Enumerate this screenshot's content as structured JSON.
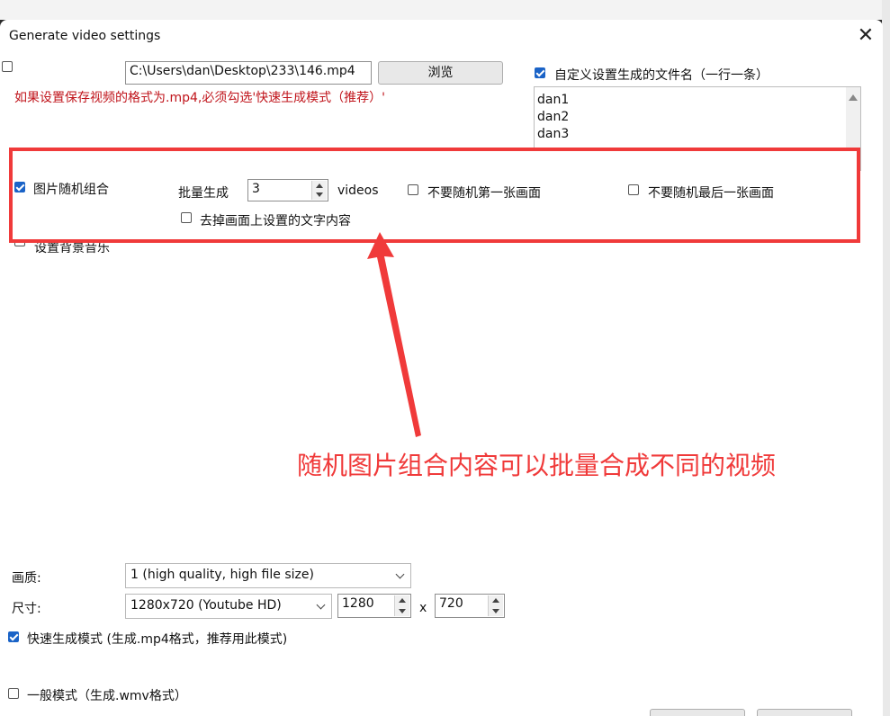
{
  "window": {
    "title": "Generate video settings",
    "close_icon": "close-icon"
  },
  "output": {
    "path_value": "C:\\Users\\dan\\Desktop\\233\\146.mp4",
    "browse_label": "浏览",
    "warning": "如果设置保存视频的格式为.mp4,必须勾选'快速生成模式（推荐）'"
  },
  "custom_name": {
    "label": "自定义设置生成的文件名（一行一条）",
    "checked": true,
    "lines": [
      "dan1",
      "dan2",
      "dan3"
    ]
  },
  "random": {
    "combine_label": "图片随机组合",
    "combine_checked": true,
    "batch_label": "批量生成",
    "batch_value": "3",
    "batch_unit": "videos",
    "no_random_first_label": "不要随机第一张画面",
    "no_random_last_label": "不要随机最后一张画面",
    "remove_text_label": "去掉画面上设置的文字内容"
  },
  "bg_music_label": "设置背景音乐",
  "annotation_text": "随机图片组合内容可以批量合成不同的视频",
  "quality": {
    "label": "画质:",
    "value": "1 (high quality, high file size)"
  },
  "size": {
    "label": "尺寸:",
    "preset": "1280x720 (Youtube HD)",
    "width": "1280",
    "x_label": "x",
    "height": "720"
  },
  "modes": {
    "fast_label": "快速生成模式 (生成.mp4格式，推荐用此模式)",
    "fast_checked": true,
    "normal_label": "一般模式（生成.wmv格式）",
    "normal_checked": false
  },
  "colors": {
    "accent": "#1a63c7",
    "annotation": "#f03a3a",
    "warning": "#c0141b"
  }
}
